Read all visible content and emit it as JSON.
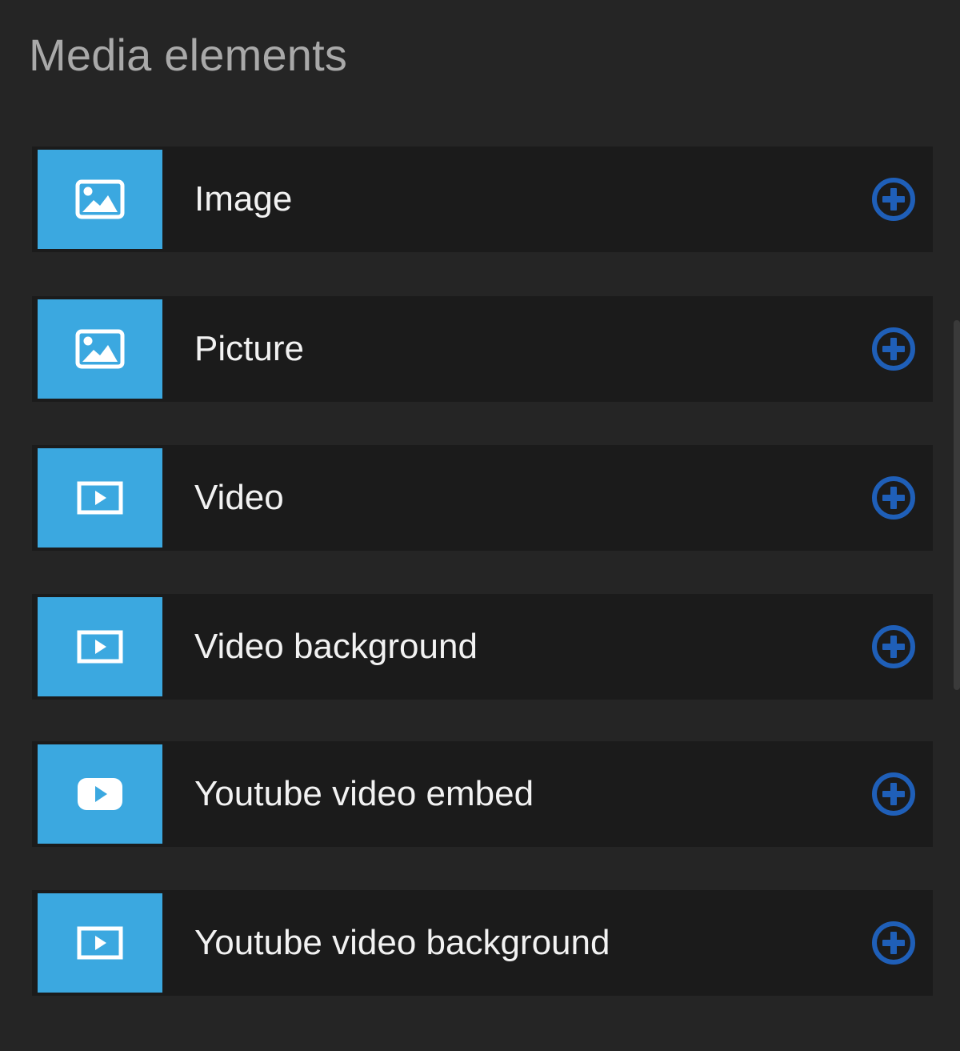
{
  "panel": {
    "title": "Media elements"
  },
  "items": [
    {
      "label": "Image",
      "icon": "image-icon"
    },
    {
      "label": "Picture",
      "icon": "image-icon"
    },
    {
      "label": "Video",
      "icon": "video-icon"
    },
    {
      "label": "Video background",
      "icon": "video-icon"
    },
    {
      "label": "Youtube video embed",
      "icon": "youtube-icon"
    },
    {
      "label": "Youtube video background",
      "icon": "video-icon"
    }
  ],
  "colors": {
    "background": "#252525",
    "item_background": "#1b1b1b",
    "icon_tile": "#3ba8e0",
    "add_icon": "#1f5fb8",
    "title_text": "#a9a9a9",
    "item_text": "#f2f2f2"
  }
}
